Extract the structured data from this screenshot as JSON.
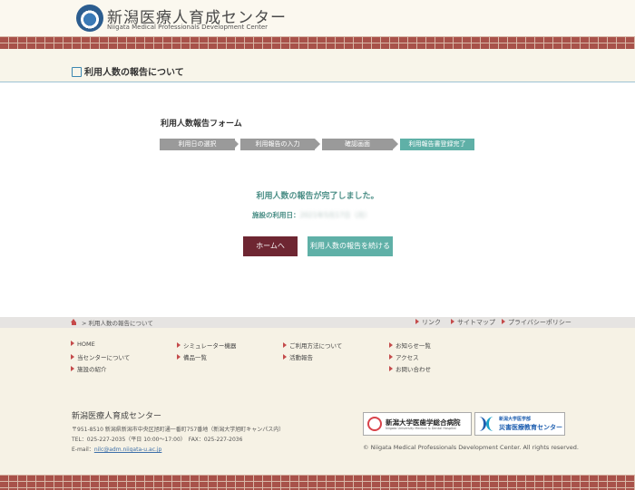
{
  "header": {
    "org_name": "新潟医療人育成センター",
    "org_name_en": "Niigata Medical Professionals Development Center"
  },
  "page_title": "利用人数の報告について",
  "form": {
    "title": "利用人数報告フォーム",
    "steps": [
      "利用日の選択",
      "利用報告の入力",
      "確認画面",
      "利用報告書登録完了"
    ],
    "complete_message": "利用人数の報告が完了しました。",
    "date_label": "施設の利用日：",
    "date_value": "2021年5月17日（月）",
    "home_button": "ホームへ",
    "continue_button": "利用人数の報告を続ける"
  },
  "breadcrumb": {
    "current": "利用人数の報告について"
  },
  "top_links": [
    "リンク",
    "サイトマップ",
    "プライバシーポリシー"
  ],
  "footer_nav": {
    "col1": [
      "HOME",
      "当センターについて",
      "施設の紹介"
    ],
    "col2": [
      "シミュレーター機器",
      "備品一覧"
    ],
    "col3": [
      "ご利用方法について",
      "活動報告"
    ],
    "col4": [
      "お知らせ一覧",
      "アクセス",
      "お問い合わせ"
    ]
  },
  "footer_info": {
    "name": "新潟医療人育成センター",
    "address": "〒951-8510 新潟県新潟市中央区旭町通一番町757番地（新潟大学旭町キャンパス内）",
    "tel": "TEL：025-227-2035（平日 10:00〜17:00）　FAX：025-227-2036",
    "email_label": "E-mail：",
    "email": "nilc@adm.niigata-u.ac.jp"
  },
  "partners": {
    "hospital": "新潟大学医歯学総合病院",
    "hospital_en": "Niigata University Medical & Dental Hospital",
    "disaster_top": "新潟大学医学部",
    "disaster": "災害医療教育センター"
  },
  "copyright": "© Niigata Medical Professionals Development Center. All rights reserved.",
  "colors": {
    "brick": "#a8524a",
    "teal": "#5fb0a7",
    "maroon": "#6e2632",
    "link_red": "#c44b4b"
  }
}
